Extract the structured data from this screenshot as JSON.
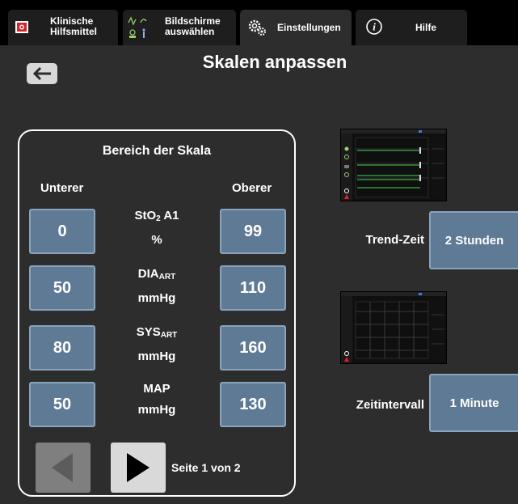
{
  "tabs": {
    "clinical_tools": "Klinische Hilfsmittel",
    "clinical_tools_line1": "Klinische",
    "clinical_tools_line2": "Hilfsmittel",
    "select_screens_line1": "Bildschirme",
    "select_screens_line2": "auswählen",
    "settings": "Einstellungen",
    "help": "Hilfe"
  },
  "page": {
    "title": "Skalen anpassen"
  },
  "scale_panel": {
    "title": "Bereich der Skala",
    "lower_header": "Unterer",
    "upper_header": "Oberer",
    "rows": [
      {
        "name": "StO",
        "sub": "2",
        "suffix": " A1",
        "unit": "%",
        "lower": "0",
        "upper": "99"
      },
      {
        "name": "DIA",
        "sub": "ART",
        "suffix": "",
        "unit": "mmHg",
        "lower": "50",
        "upper": "110"
      },
      {
        "name": "SYS",
        "sub": "ART",
        "suffix": "",
        "unit": "mmHg",
        "lower": "80",
        "upper": "160"
      },
      {
        "name": "MAP",
        "sub": "",
        "suffix": "",
        "unit": "mmHg",
        "lower": "50",
        "upper": "130"
      }
    ],
    "page_indicator": "Seite 1 von 2"
  },
  "trend_time": {
    "label": "Trend-Zeit",
    "value": "2 Stunden"
  },
  "time_interval": {
    "label": "Zeitintervall",
    "value": "1 Minute"
  },
  "colors": {
    "button_fill": "#5f7a95",
    "button_border": "#8aa3bb",
    "background": "#2d2d2d",
    "tab_bar": "#000000",
    "alert_red": "#d9222a"
  }
}
